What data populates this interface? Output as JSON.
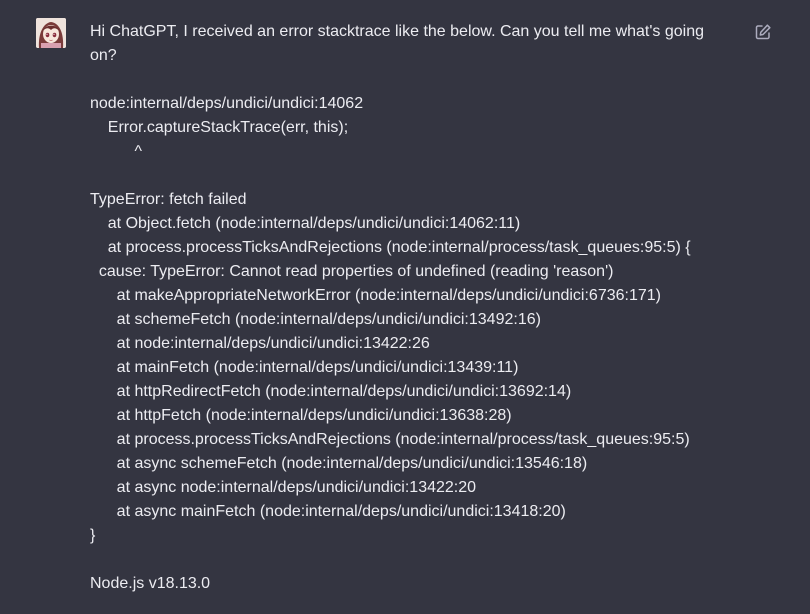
{
  "user_message": {
    "intro": "Hi ChatGPT, I received an error stacktrace like the below. Can you tell me what's going on?",
    "trace_header": [
      "node:internal/deps/undici/undici:14062",
      "    Error.captureStackTrace(err, this);",
      "          ^"
    ],
    "trace_body": [
      "TypeError: fetch failed",
      "    at Object.fetch (node:internal/deps/undici/undici:14062:11)",
      "    at process.processTicksAndRejections (node:internal/process/task_queues:95:5) {",
      "  cause: TypeError: Cannot read properties of undefined (reading 'reason')",
      "      at makeAppropriateNetworkError (node:internal/deps/undici/undici:6736:171)",
      "      at schemeFetch (node:internal/deps/undici/undici:13492:16)",
      "      at node:internal/deps/undici/undici:13422:26",
      "      at mainFetch (node:internal/deps/undici/undici:13439:11)",
      "      at httpRedirectFetch (node:internal/deps/undici/undici:13692:14)",
      "      at httpFetch (node:internal/deps/undici/undici:13638:28)",
      "      at process.processTicksAndRejections (node:internal/process/task_queues:95:5)",
      "      at async schemeFetch (node:internal/deps/undici/undici:13546:18)",
      "      at async node:internal/deps/undici/undici:13422:20",
      "      at async mainFetch (node:internal/deps/undici/undici:13418:20)",
      "}"
    ],
    "footer": "Node.js v18.13.0"
  },
  "icons": {
    "avatar": "user-avatar",
    "edit": "edit-icon"
  },
  "colors": {
    "background": "#343541",
    "text": "#ececf1",
    "icon": "#acacbe"
  }
}
